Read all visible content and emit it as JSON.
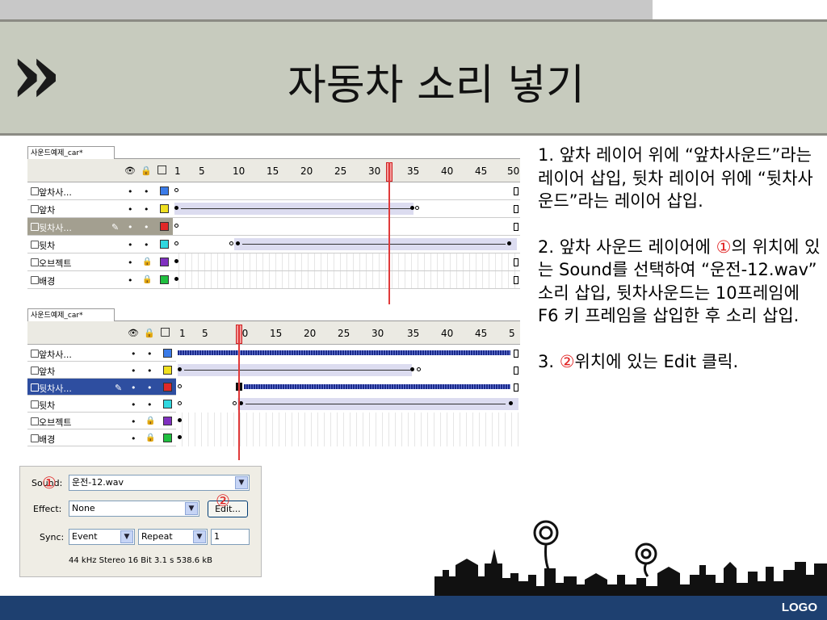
{
  "slide": {
    "title": "자동차 소리 넣기",
    "chevron": "»",
    "logo": "LOGO",
    "colors": {
      "header_bg": "#c7cbbe",
      "footer_bg": "#1e4070",
      "accent_red": "#e02020"
    }
  },
  "timeline": {
    "tab_label": "사운드예제_car*",
    "header_icons": {
      "eye": "👁",
      "lock": "🔒",
      "outline": "□"
    },
    "frame_numbers": [
      "1",
      "5",
      "10",
      "15",
      "20",
      "25",
      "30",
      "35",
      "40",
      "45",
      "50"
    ],
    "frame_numbers_b": [
      "1",
      "5",
      "10",
      "15",
      "20",
      "25",
      "30",
      "35",
      "40",
      "45",
      "5"
    ],
    "layers": [
      {
        "name": "앞차사...",
        "color": "#3b7be8"
      },
      {
        "name": "앞차",
        "color": "#f0e020"
      },
      {
        "name": "뒷차사...",
        "color": "#e02828"
      },
      {
        "name": "뒷차",
        "color": "#30d8e0"
      },
      {
        "name": "오브젝트",
        "color": "#8030c0"
      },
      {
        "name": "배경",
        "color": "#20c040"
      }
    ],
    "pencil_icon": "✎",
    "bullet": "•",
    "lock_glyph": "🔒"
  },
  "properties": {
    "sound_label": "Sound:",
    "sound_value": "운전-12.wav",
    "effect_label": "Effect:",
    "effect_value": "None",
    "edit_button": "Edit...",
    "sync_label": "Sync:",
    "sync_value": "Event",
    "repeat_value": "Repeat",
    "repeat_count": "1",
    "info": "44 kHz Stereo 16 Bit 3.1 s 538.6 kB",
    "marker1": "①",
    "marker2": "②"
  },
  "instructions": {
    "p1": "1. 앞차 레이어 위에 “앞차사운드”라는 레이어 삽입, 뒷차 레이어 위에 “뒷차사운드”라는 레이어 삽입.",
    "p2_a": "2. 앞차 사운드 레이어에 ",
    "p2_mark": "①",
    "p2_b": "의 위치에 있는 Sound를 선택하여 “운전-12.wav” 소리 삽입, 뒷차사운드는 10프레임에 F6 키 프레임을 삽입한 후 소리 삽입.",
    "p3_a": "3. ",
    "p3_mark": "②",
    "p3_b": "위치에 있는 Edit 클릭."
  }
}
